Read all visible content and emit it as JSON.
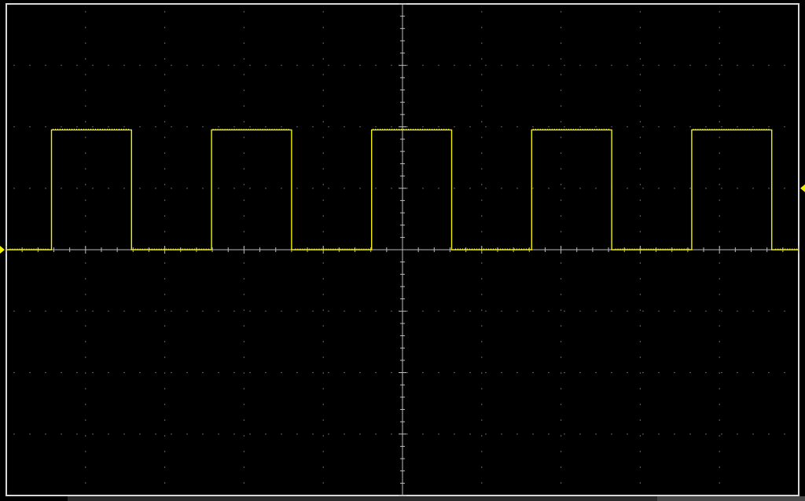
{
  "colors": {
    "background": "#000000",
    "frame": "#d8d8d8",
    "grid_dots": "#8a8a8a",
    "center_axes": "#bdbdbd",
    "trace": "#f2f200",
    "markers": "#f2f200"
  },
  "chart_data": {
    "type": "line",
    "title": "",
    "xlabel": "",
    "ylabel": "",
    "grid": true,
    "x_divisions": 10,
    "y_divisions": 8,
    "xlim": [
      -5,
      5
    ],
    "ylim": [
      -4,
      4
    ],
    "series": [
      {
        "channel_color": "#f2f200",
        "x": [
          -5.0,
          -4.43,
          -4.43,
          -3.42,
          -3.42,
          -2.41,
          -2.41,
          -1.4,
          -1.4,
          -0.39,
          -0.39,
          0.62,
          0.62,
          1.63,
          1.63,
          2.64,
          2.64,
          3.65,
          3.65,
          4.66,
          4.66,
          5.0
        ],
        "y": [
          0.0,
          0.0,
          1.95,
          1.95,
          0.0,
          0.0,
          1.95,
          1.95,
          0.0,
          0.0,
          1.95,
          1.95,
          0.0,
          0.0,
          1.95,
          1.95,
          0.0,
          0.0,
          1.95,
          1.95,
          0.0,
          0.0
        ]
      }
    ],
    "markers": {
      "ground_level": 0.0,
      "trigger_level": 1.0
    }
  }
}
